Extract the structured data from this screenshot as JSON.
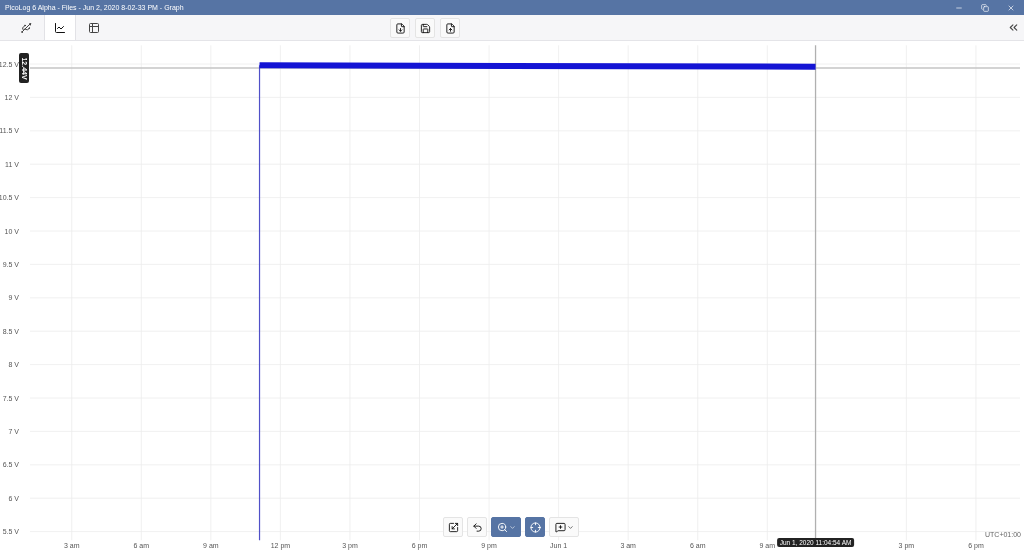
{
  "window": {
    "title": "PicoLog 6 Alpha - Files - Jun 2, 2020 8-02-33 PM - Graph"
  },
  "view_tabs": [
    {
      "kind": "devices",
      "selected": false
    },
    {
      "kind": "graph",
      "selected": true
    },
    {
      "kind": "table",
      "selected": false
    }
  ],
  "graph": {
    "chart_data": {
      "type": "line",
      "grid": true,
      "x": [
        "2020-05-31T11:06:00",
        "2020-06-01T11:04:54"
      ],
      "series": [
        {
          "color": "#1414d4",
          "values": [
            12.48,
            12.46
          ]
        }
      ],
      "xlim": [
        "2020-05-31T01:12:00",
        "2020-06-01T19:54:00"
      ],
      "ylim": [
        5.37,
        12.78
      ],
      "xticks": [
        {
          "value": "2020-05-31T03:00:00",
          "label": "3 am"
        },
        {
          "value": "2020-05-31T06:00:00",
          "label": "6 am"
        },
        {
          "value": "2020-05-31T09:00:00",
          "label": "9 am"
        },
        {
          "value": "2020-05-31T12:00:00",
          "label": "12 pm"
        },
        {
          "value": "2020-05-31T15:00:00",
          "label": "3 pm"
        },
        {
          "value": "2020-05-31T18:00:00",
          "label": "6 pm"
        },
        {
          "value": "2020-05-31T21:00:00",
          "label": "9 pm"
        },
        {
          "value": "2020-06-01T00:00:00",
          "label": "Jun 1"
        },
        {
          "value": "2020-06-01T03:00:00",
          "label": "3 am"
        },
        {
          "value": "2020-06-01T06:00:00",
          "label": "6 am"
        },
        {
          "value": "2020-06-01T09:00:00",
          "label": "9 am"
        },
        {
          "value": "2020-06-01T15:00:00",
          "label": "3 pm"
        },
        {
          "value": "2020-06-01T18:00:00",
          "label": "6 pm"
        }
      ],
      "yticks": [
        {
          "value": 5.5,
          "label": "5.5 V"
        },
        {
          "value": 6,
          "label": "6 V"
        },
        {
          "value": 6.5,
          "label": "6.5 V"
        },
        {
          "value": 7,
          "label": "7 V"
        },
        {
          "value": 7.5,
          "label": "7.5 V"
        },
        {
          "value": 8,
          "label": "8 V"
        },
        {
          "value": 8.5,
          "label": "8.5 V"
        },
        {
          "value": 9,
          "label": "9 V"
        },
        {
          "value": 9.5,
          "label": "9.5 V"
        },
        {
          "value": 10,
          "label": "10 V"
        },
        {
          "value": 10.5,
          "label": "10.5 V"
        },
        {
          "value": 11,
          "label": "11 V"
        },
        {
          "value": 11.5,
          "label": "11.5 V"
        },
        {
          "value": 12,
          "label": "12 V"
        },
        {
          "value": 12.5,
          "label": "12.5 V"
        }
      ],
      "ref_lines": [
        {
          "axis": "y",
          "value": 12.44,
          "color": "#c4c4c4"
        },
        {
          "axis": "x",
          "value": "2020-06-01T11:04:54",
          "color": "#b0b0b0"
        },
        {
          "axis": "x",
          "value": "2020-05-31T11:06:00",
          "color": "#5050c8"
        }
      ]
    },
    "cursor": {
      "value_label": "12.44V",
      "time_label": "Jun 1, 2020 11:04:54 AM"
    },
    "timezone": "UTC+01:00"
  },
  "graph_tools": [
    {
      "kind": "autoscale",
      "selected": false,
      "dropdown": false
    },
    {
      "kind": "undo",
      "selected": false,
      "dropdown": false
    },
    {
      "kind": "zoom",
      "selected": true,
      "dropdown": true
    },
    {
      "kind": "cursor",
      "selected": true,
      "dropdown": false
    },
    {
      "kind": "annotate",
      "selected": false,
      "dropdown": true
    }
  ]
}
